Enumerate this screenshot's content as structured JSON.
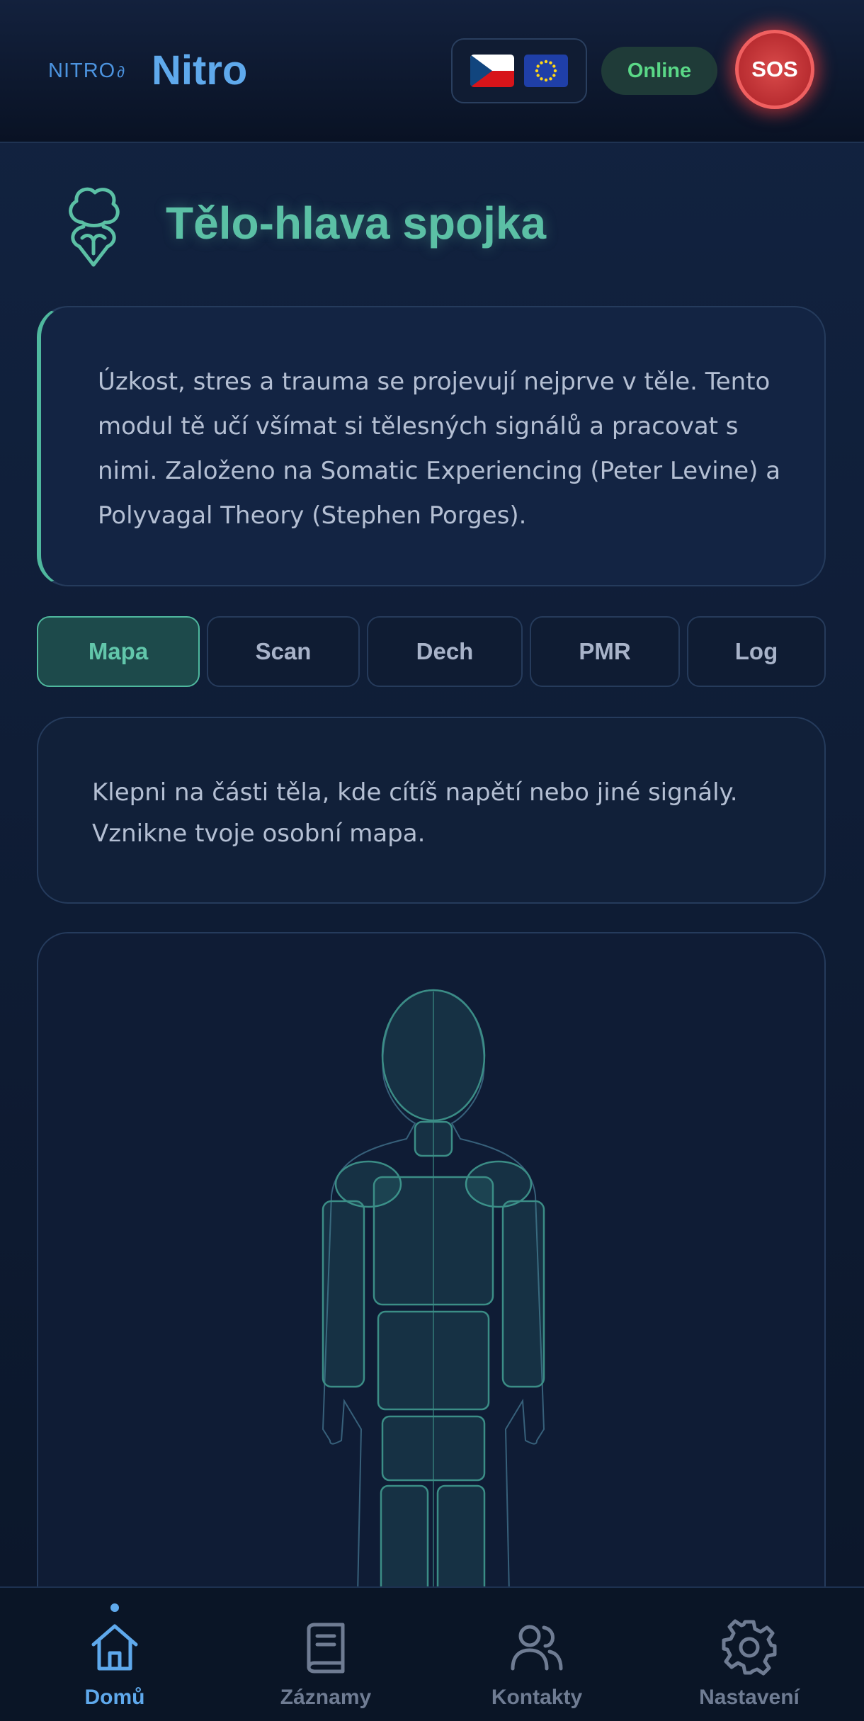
{
  "header": {
    "logo_text": "NITRO",
    "app_title": "Nitro",
    "languages": [
      "cz-flag",
      "eu-flag"
    ],
    "status": "Online",
    "sos_label": "SOS"
  },
  "page": {
    "icon": "brain-heart-icon",
    "title": "Tělo-hlava spojka",
    "intro": "Úzkost, stres a trauma se projevují nejprve v těle. Tento modul tě učí všímat si tělesných signálů a pracovat s nimi. Založeno na Somatic Experiencing (Peter Levine) a Polyvagal Theory (Stephen Porges)."
  },
  "tabs": [
    {
      "label": "Mapa",
      "active": true
    },
    {
      "label": "Scan",
      "active": false
    },
    {
      "label": "Dech",
      "active": false
    },
    {
      "label": "PMR",
      "active": false
    },
    {
      "label": "Log",
      "active": false
    }
  ],
  "hint": "Klepni na části těla, kde cítíš napětí nebo jiné signály. Vznikne tvoje osobní mapa.",
  "body_map": {
    "parts": [
      "head",
      "neck",
      "left-shoulder",
      "right-shoulder",
      "chest",
      "left-arm",
      "right-arm",
      "abdomen",
      "pelvis",
      "left-leg",
      "right-leg"
    ]
  },
  "nav": [
    {
      "label": "Domů",
      "icon": "home-icon",
      "active": true
    },
    {
      "label": "Záznamy",
      "icon": "book-icon",
      "active": false
    },
    {
      "label": "Kontakty",
      "icon": "users-icon",
      "active": false
    },
    {
      "label": "Nastavení",
      "icon": "gear-icon",
      "active": false
    }
  ],
  "colors": {
    "accent_teal": "#5bc0a5",
    "accent_blue": "#5fa9ec",
    "online_green": "#5ad887",
    "sos_red": "#d94a4a",
    "background": "#0f1c33"
  }
}
